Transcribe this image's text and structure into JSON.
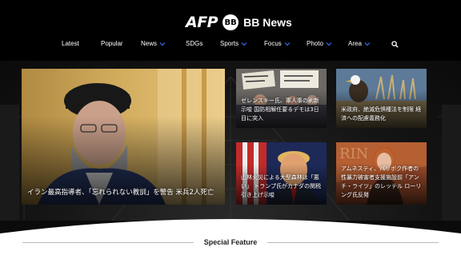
{
  "brand": {
    "logo_text": "AFP",
    "badge_text": "BB",
    "site_name": "BB News"
  },
  "nav": {
    "items": [
      {
        "label": "Latest",
        "has_dropdown": false
      },
      {
        "label": "Popular",
        "has_dropdown": false
      },
      {
        "label": "News",
        "has_dropdown": true
      },
      {
        "label": "SDGs",
        "has_dropdown": false
      },
      {
        "label": "Sports",
        "has_dropdown": true
      },
      {
        "label": "Focus",
        "has_dropdown": true
      },
      {
        "label": "Photo",
        "has_dropdown": true
      },
      {
        "label": "Area",
        "has_dropdown": true
      }
    ],
    "search_icon": "search-icon"
  },
  "headlines": {
    "main": "イラン最高指導者、「忘れられない教訓」を警告 米兵2人死亡",
    "top_middle": "ゼレンスキー氏、軍人事の刷新示唆 国防相解任要るデモは3日目に突入",
    "top_right": "米政府、絶滅危惧種法を制限 経済への配慮義務化",
    "bottom_middle": "山林火災による大型森林は「悪い」 トランプ氏がカナダの関税引き上げ示唆",
    "bottom_right": "アムネスティ、パリボク作者の性暴力被害者支援施設前「アンチ・ライツ」のレッテル ローリング氏反発"
  },
  "section": {
    "title": "Special Feature"
  },
  "colors": {
    "header_bg": "#000000",
    "accent": "#1e4fd8"
  }
}
